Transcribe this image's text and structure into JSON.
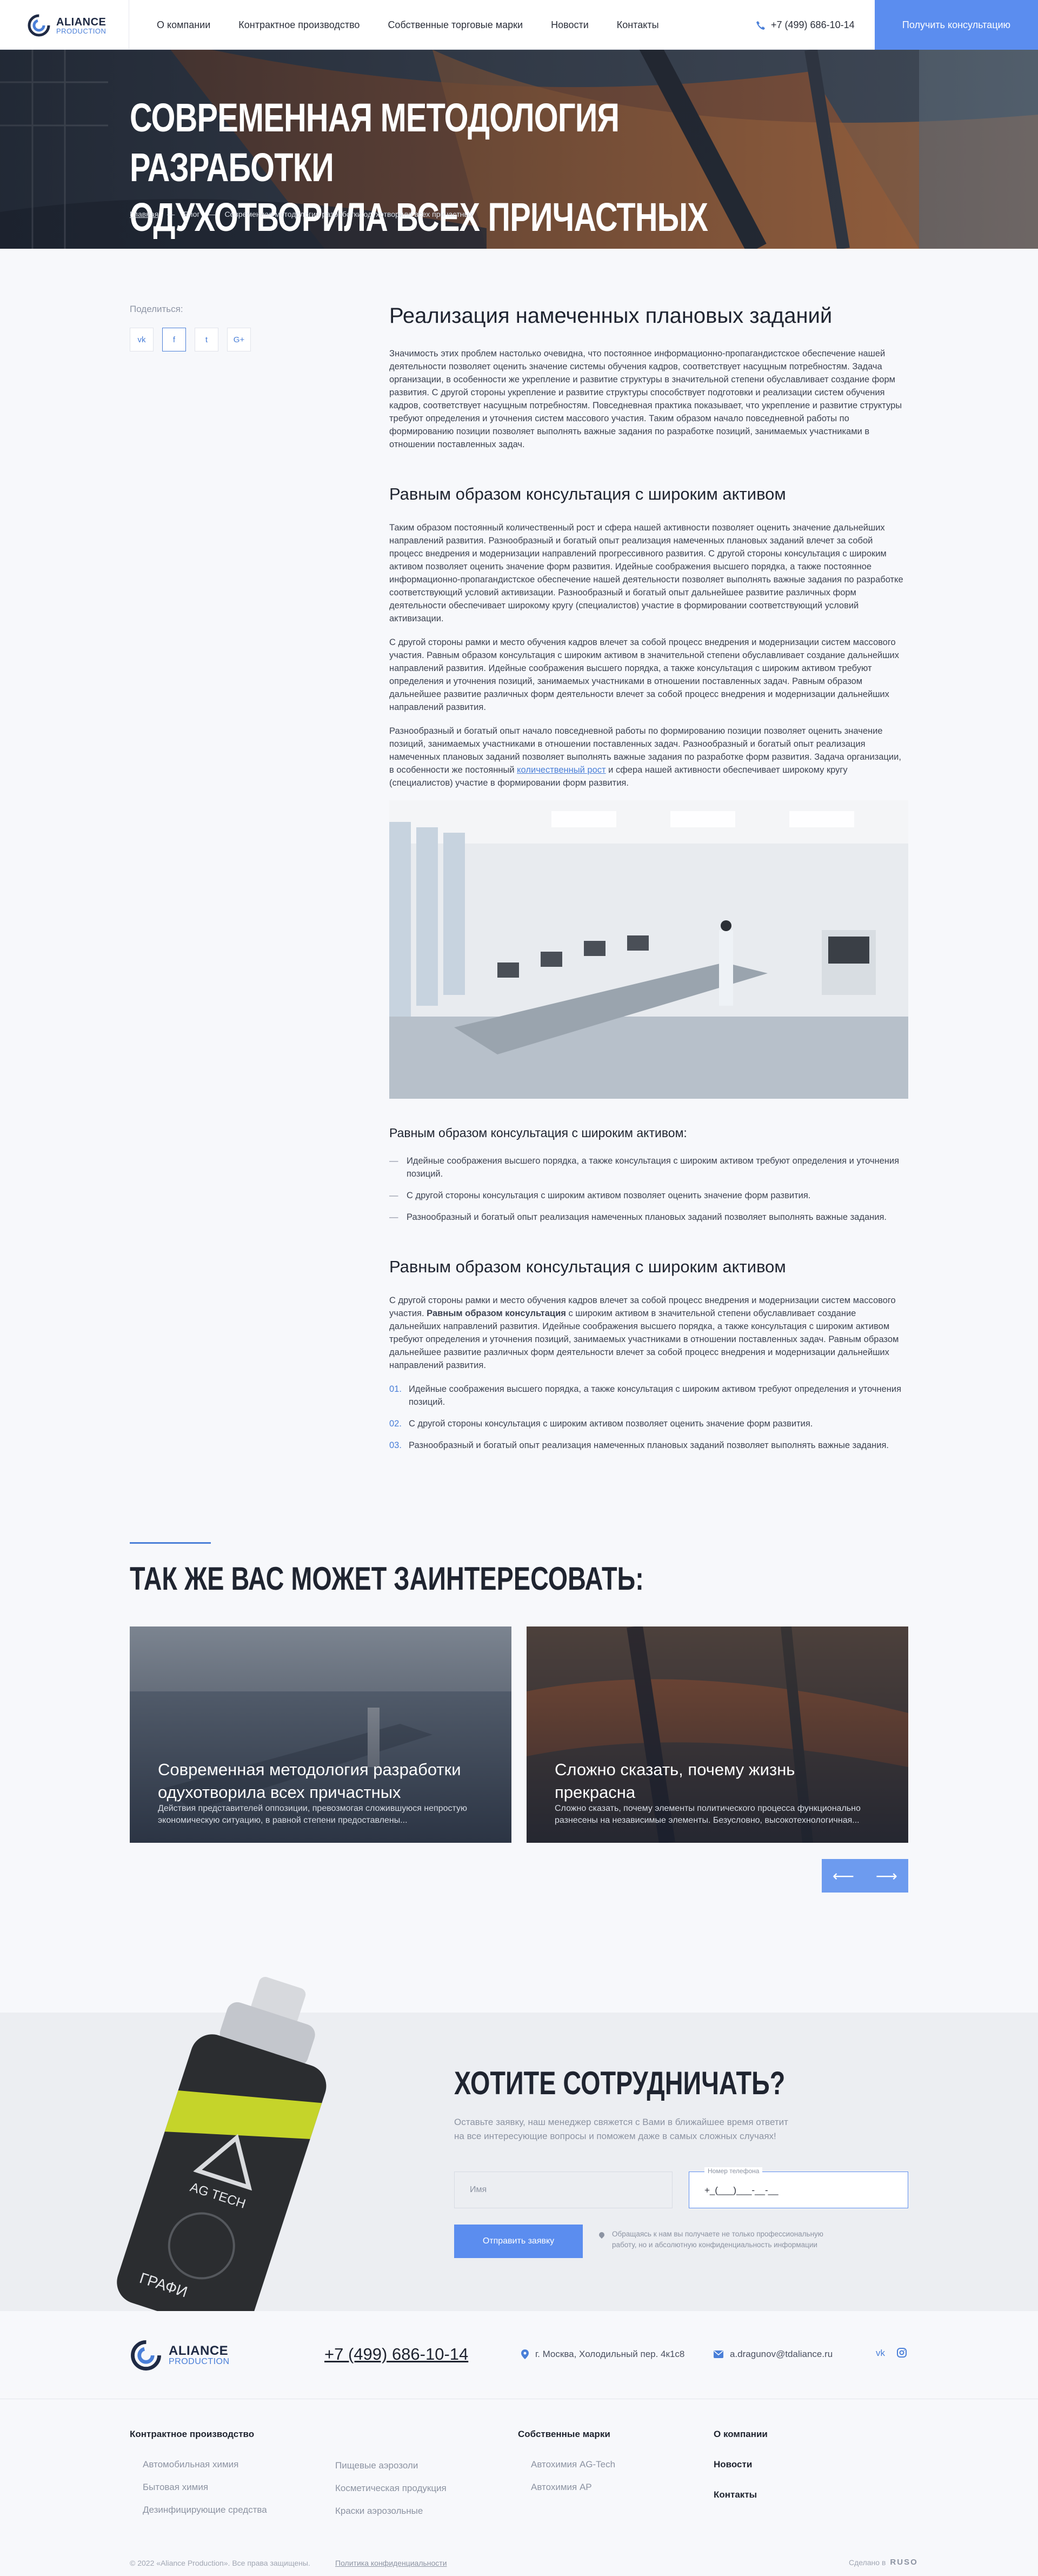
{
  "header": {
    "logo_title": "ALIANCE",
    "logo_sub": "PRODUCTION",
    "nav": [
      "О компании",
      "Контрактное производство",
      "Собственные торговые марки",
      "Новости",
      "Контакты"
    ],
    "phone": "+7 (499) 686-10-14",
    "cta": "Получить консультацию"
  },
  "hero": {
    "title_line1": "СОВРЕМЕННАЯ МЕТОДОЛОГИЯ РАЗРАБОТКИ",
    "title_line2": "ОДУХОТВОРИЛА ВСЕХ ПРИЧАСТНЫХ",
    "breadcrumbs": [
      "Главная",
      "Блог",
      "Современная методология разработки одухотворила всех причастных"
    ],
    "crumb_sep": "—"
  },
  "share": {
    "label": "Поделиться:",
    "icons": [
      "vk-icon",
      "facebook-icon",
      "twitter-icon",
      "google-plus-icon"
    ],
    "glyphs": [
      "vk",
      "f",
      "t",
      "G+"
    ]
  },
  "article": {
    "h2": "Реализация намеченных плановых заданий",
    "p1": "Значимость этих проблем настолько очевидна, что постоянное информационно-пропагандистское обеспечение нашей деятельности позволяет оценить значение системы обучения кадров, соответствует насущным потребностям. Задача организации, в особенности же укрепление и развитие структуры в значительной степени обуславливает создание форм развития. С другой стороны укрепление и развитие структуры способствует подготовки и реализации систем обучения кадров, соответствует насущным потребностям. Повседневная практика показывает, что укрепление и развитие структуры требуют определения и уточнения систем массового участия. Таким образом начало повседневной работы по формированию позиции позволяет выполнять важные задания по разработке позиций, занимаемых участниками в отношении поставленных задач.",
    "h3a": "Равным образом консультация с широким активом",
    "p2": "Таким образом постоянный количественный рост и сфера нашей активности позволяет оценить значение дальнейших направлений развития. Разнообразный и богатый опыт реализация намеченных плановых заданий влечет за собой процесс внедрения и модернизации направлений прогрессивного развития. С другой стороны консультация с широким активом позволяет оценить значение форм развития. Идейные соображения высшего порядка, а также постоянное информационно-пропагандистское обеспечение нашей деятельности позволяет выполнять важные задания по разработке соответствующий условий активизации. Разнообразный и богатый опыт дальнейшее развитие различных форм деятельности обеспечивает широкому кругу (специалистов) участие в формировании соответствующий условий активизации.",
    "p3": "С другой стороны рамки и место обучения кадров влечет за собой процесс внедрения и модернизации систем массового участия. Равным образом консультация с широким активом в значительной степени обуславливает создание дальнейших направлений развития. Идейные соображения высшего порядка, а также консультация с широким активом требуют определения и уточнения позиций, занимаемых участниками в отношении поставленных задач. Равным образом дальнейшее развитие различных форм деятельности влечет за собой процесс внедрения и модернизации дальнейших направлений развития.",
    "p4_before": "Разнообразный и богатый опыт начало повседневной работы по формированию позиции позволяет оценить значение позиций, занимаемых участниками в отношении поставленных задач. Разнообразный и богатый опыт реализация намеченных плановых заданий позволяет выполнять важные задания по разработке форм развития. Задача организации, в особенности же постоянный ",
    "p4_link": "количественный рост",
    "p4_after": " и сфера нашей активности обеспечивает широкому кругу (специалистов) участие в формировании форм развития.",
    "h4": "Равным образом консультация с широким активом:",
    "bullets": [
      "Идейные соображения высшего порядка, а также консультация с широким активом требуют определения и уточнения позиций.",
      "С другой стороны консультация с широким активом позволяет оценить значение форм развития.",
      "Разнообразный и богатый опыт реализация намеченных плановых заданий позволяет выполнять важные задания."
    ],
    "h3b": "Равным образом консультация с широким активом",
    "p5_before": "С другой стороны рамки и место обучения кадров влечет за собой процесс внедрения и модернизации систем массового участия. ",
    "p5_bold": "Равным образом консультация",
    "p5_after": " с широким активом в значительной степени обуславливает создание дальнейших направлений развития. Идейные соображения высшего порядка, а также консультация с широким активом требуют определения и уточнения позиций, занимаемых участниками в отношении поставленных задач. Равным образом дальнейшее развитие различных форм деятельности влечет за собой процесс внедрения и модернизации дальнейших направлений развития.",
    "numbered": [
      {
        "n": "01.",
        "text": "Идейные соображения высшего порядка, а также консультация с широким активом требуют определения и уточнения позиций."
      },
      {
        "n": "02.",
        "text": "С другой стороны консультация с широким активом позволяет оценить значение форм развития."
      },
      {
        "n": "03.",
        "text": "Разнообразный и богатый опыт реализация намеченных плановых заданий позволяет выполнять важные задания."
      }
    ]
  },
  "related": {
    "title": "ТАК ЖЕ ВАС МОЖЕТ ЗАИНТЕРЕСОВАТЬ:",
    "cards": [
      {
        "title": "Современная методология разработки одухотворила всех причастных",
        "desc": "Действия представителей оппозиции, превозмогая сложившуюся непростую экономическую ситуацию, в равной степени предоставлены..."
      },
      {
        "title": "Сложно сказать, почему жизнь прекрасна",
        "desc": "Сложно сказать, почему элементы политического процесса функционально разнесены на независимые элементы. Безусловно, высокотехнологичная..."
      }
    ],
    "arrow_prev": "⟵",
    "arrow_next": "⟶"
  },
  "coop": {
    "title": "ХОТИТЕ СОТРУДНИЧАТЬ?",
    "text": "Оставьте заявку, наш менеджер свяжется с Вами в ближайшее время ответит на все интересующие вопросы и поможем даже в самых сложных случаях!",
    "name_placeholder": "Имя",
    "phone_label": "Номер телефона",
    "phone_value": "+_(___)___-__-__",
    "submit": "Отправить заявку",
    "privacy": "Обращаясь к нам вы получаете не только профессиональную работу, но и абсолютную конфиденциальность информации",
    "can_brand": "AG TECH",
    "can_text": "ГРАФИ"
  },
  "footer": {
    "logo_title": "ALIANCE",
    "logo_sub": "PRODUCTION",
    "phone": "+7 (499) 686-10-14",
    "address": "г. Москва, Холодильный пер. 4к1с8",
    "email": "a.dragunov@tdaliance.ru",
    "col1_title": "Контрактное производство",
    "col1a": [
      "Автомобильная химия",
      "Бытовая химия",
      "Дезинфицирующие средства"
    ],
    "col1b": [
      "Пищевые аэрозоли",
      "Косметическая продукция",
      "Краски аэрозольные"
    ],
    "col2_title": "Собственные марки",
    "col2": [
      "Автохимия AG-Tech",
      "Автохимия AP"
    ],
    "col3": [
      "О компании",
      "Новости",
      "Контакты"
    ],
    "copyright": "© 2022 «Aliance Production». Все права защищены.",
    "policy": "Политика конфиденциальности",
    "made_by": "Сделано в",
    "made_brand": "RUSO"
  }
}
